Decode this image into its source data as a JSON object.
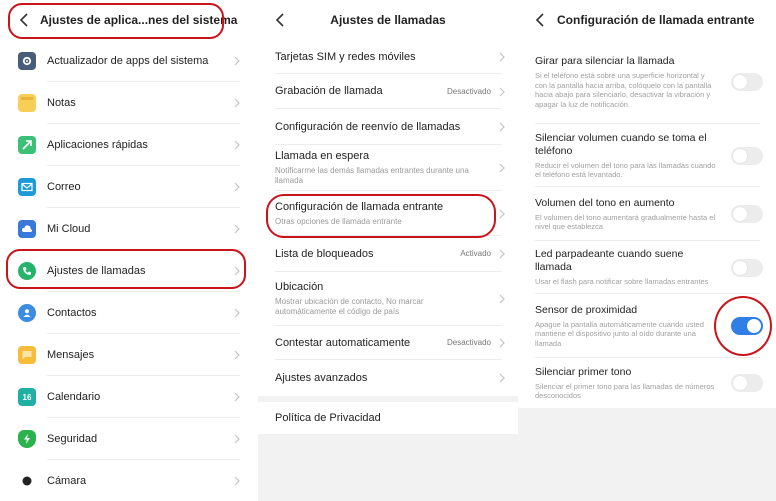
{
  "panels": {
    "app_settings": {
      "title": "Ajustes de aplica...nes del sistema",
      "items": [
        {
          "label": "Actualizador de apps del sistema",
          "icon": "gear-icon",
          "color": "#4a5d78"
        },
        {
          "label": "Notas",
          "icon": "notes-icon",
          "color": "#f7cf57"
        },
        {
          "label": "Aplicaciones rápidas",
          "icon": "quick-apps-icon",
          "color": "#3cbf77"
        },
        {
          "label": "Correo",
          "icon": "mail-icon",
          "color": "#1e9bd7"
        },
        {
          "label": "Mi Cloud",
          "icon": "cloud-icon",
          "color": "#3a79d9"
        },
        {
          "label": "Ajustes de llamadas",
          "icon": "phone-icon",
          "color": "#26b36b"
        },
        {
          "label": "Contactos",
          "icon": "contacts-icon",
          "color": "#3b8ce3"
        },
        {
          "label": "Mensajes",
          "icon": "messages-icon",
          "color": "#f7bc3a"
        },
        {
          "label": "Calendario",
          "icon": "calendar-icon",
          "color": "#1fb0a3",
          "icon_text": "16"
        },
        {
          "label": "Seguridad",
          "icon": "shield-icon",
          "color": "#2bb24c"
        },
        {
          "label": "Cámara",
          "icon": "camera-icon",
          "color": "#222222"
        }
      ]
    },
    "call_settings": {
      "title": "Ajustes de llamadas",
      "items": [
        {
          "label": "Tarjetas SIM y redes móviles",
          "sub": "",
          "value": ""
        },
        {
          "label": "Grabación de llamada",
          "sub": "",
          "value": "Desactivado"
        },
        {
          "label": "Configuración de reenvío de llamadas",
          "sub": "",
          "value": ""
        },
        {
          "label": "Llamada en espera",
          "sub": "Notificarme las demás llamadas entrantes durante una llamada",
          "value": ""
        },
        {
          "label": "Configuración de llamada entrante",
          "sub": "Otras opciones de llamada entrante",
          "value": ""
        },
        {
          "label": "Lista de bloqueados",
          "sub": "",
          "value": "Activado"
        },
        {
          "label": "Ubicación",
          "sub": "Mostrar ubicación de contacto, No marcar automáticamente el código de país",
          "value": ""
        },
        {
          "label": "Contestar automaticamente",
          "sub": "",
          "value": "Desactivado"
        },
        {
          "label": "Ajustes avanzados",
          "sub": "",
          "value": ""
        }
      ],
      "privacy": "Política de Privacidad"
    },
    "incoming_call": {
      "title": "Configuración de llamada entrante",
      "items": [
        {
          "label": "Girar para silenciar la llamada",
          "sub": "Si el teléfono está sobre una superficie horizontal y con la pantalla hacia arriba, colóquelo con la pantalla hacia abajo para silenciarlo, desactivar la vibración y apagar la luz de notificación.",
          "on": false
        },
        {
          "label": "Silenciar volumen cuando se toma el teléfono",
          "sub": "Reducir el volumen del tono para las llamadas cuando el teléfono está levantado.",
          "on": false
        },
        {
          "label": "Volumen del tono en aumento",
          "sub": "El volumen del tono aumentará gradualmente hasta el nivel que establezca",
          "on": false
        },
        {
          "label": "Led parpadeante cuando suene llamada",
          "sub": "Usar el flash para notificar sobre llamadas entrantes",
          "on": false
        },
        {
          "label": "Sensor de proximidad",
          "sub": "Apague la pantalla automáticamente cuando usted mantiene el dispositivo junto al oído durante una llamada",
          "on": true
        },
        {
          "label": "Silenciar primer tono",
          "sub": "Silenciar el primer tono para las llamadas de números desconocidos",
          "on": false
        }
      ]
    }
  },
  "annotation_color": "#c9141a",
  "toggle_on_color": "#2f7fe6"
}
